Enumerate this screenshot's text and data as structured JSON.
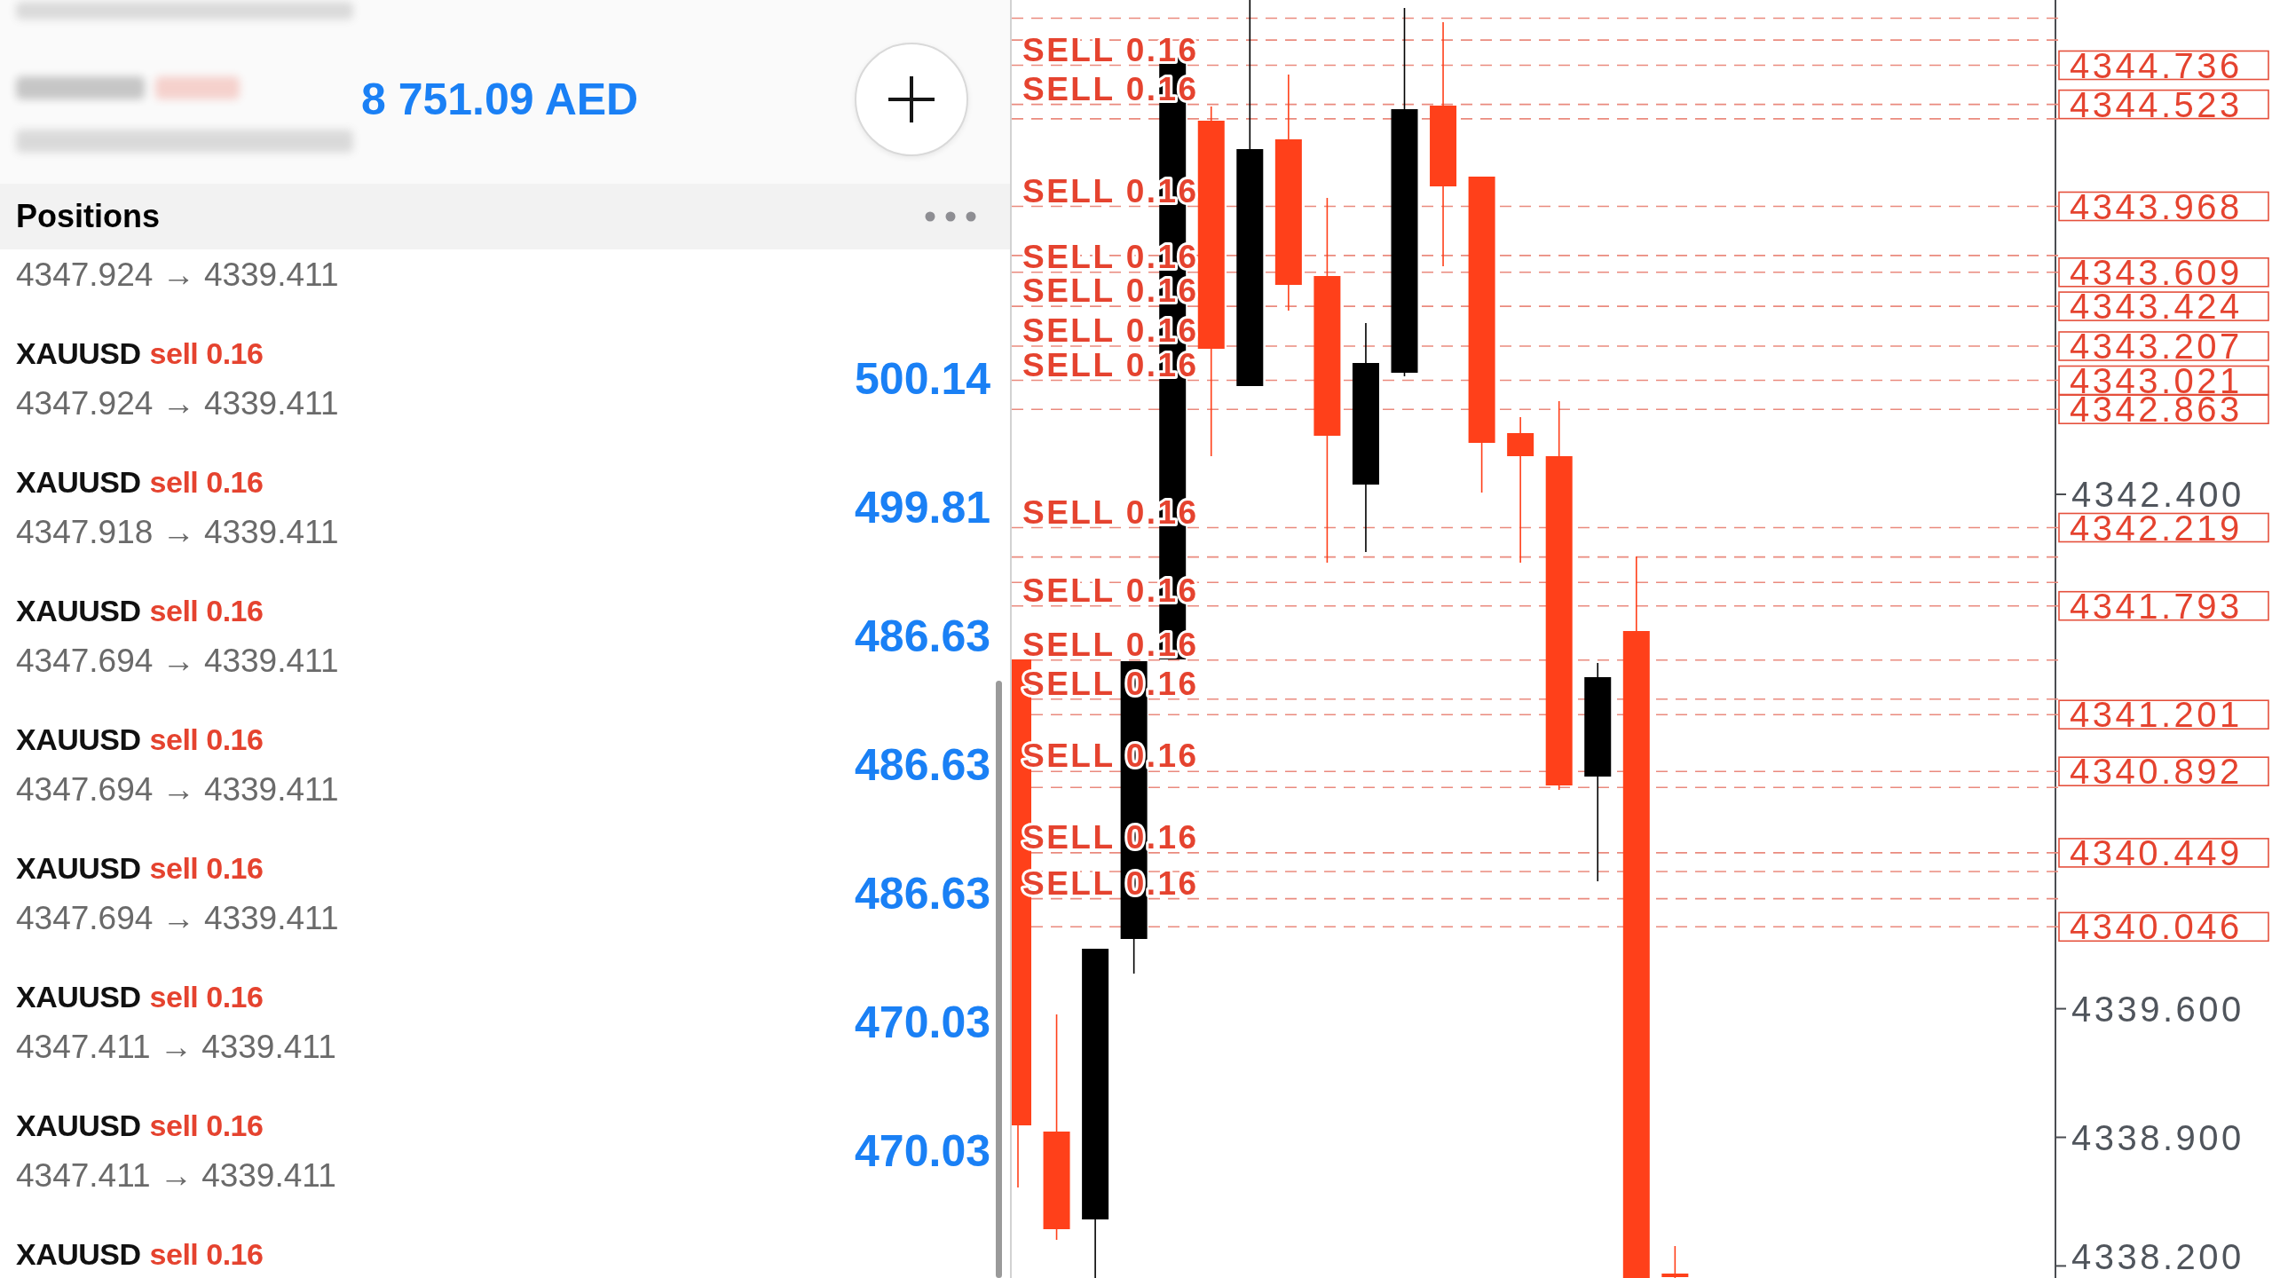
{
  "header": {
    "balance": "8 751.09 AED"
  },
  "positions": {
    "title": "Positions",
    "rows": [
      {
        "price_line": "4347.924 → 4339.411"
      },
      {
        "symbol": "XAUUSD",
        "order": "sell 0.16",
        "price_line": "4347.924 → 4339.411",
        "profit": "500.14"
      },
      {
        "symbol": "XAUUSD",
        "order": "sell 0.16",
        "price_line": "4347.918 → 4339.411",
        "profit": "499.81"
      },
      {
        "symbol": "XAUUSD",
        "order": "sell 0.16",
        "price_line": "4347.694 → 4339.411",
        "profit": "486.63"
      },
      {
        "symbol": "XAUUSD",
        "order": "sell 0.16",
        "price_line": "4347.694 → 4339.411",
        "profit": "486.63"
      },
      {
        "symbol": "XAUUSD",
        "order": "sell 0.16",
        "price_line": "4347.694 → 4339.411",
        "profit": "486.63"
      },
      {
        "symbol": "XAUUSD",
        "order": "sell 0.16",
        "price_line": "4347.411 → 4339.411",
        "profit": "470.03"
      },
      {
        "symbol": "XAUUSD",
        "order": "sell 0.16",
        "price_line": "4347.411 → 4339.411",
        "profit": "470.03"
      },
      {
        "symbol": "XAUUSD",
        "order": "sell 0.16"
      }
    ]
  },
  "chart": {
    "orders": [
      {
        "tag": "4344.736",
        "label": "SELL 0.16"
      },
      {
        "tag": "4344.523",
        "label": "SELL 0.16"
      },
      {
        "tag": "4343.968",
        "label": "SELL 0.16"
      },
      {
        "tag": "4343.609",
        "label": "SELL 0.16"
      },
      {
        "tag": "4343.424",
        "label": "SELL 0.16"
      },
      {
        "tag": "4343.207",
        "label": "SELL 0.16"
      },
      {
        "tag": "4343.021",
        "label": "SELL 0.16"
      },
      {
        "tag": "4342.863"
      },
      {
        "tag": "4342.219",
        "label": "SELL 0.16"
      },
      {
        "tag": "4341.793",
        "label": "SELL 0.16"
      },
      {
        "label": "SELL 0.16"
      },
      {
        "label": "SELL 0.16"
      },
      {
        "tag": "4341.201"
      },
      {
        "tag": "4340.892",
        "label": "SELL 0.16"
      },
      {
        "tag": "4340.449",
        "label": "SELL 0.16"
      },
      {
        "label": "SELL 0.16"
      },
      {
        "tag": "4340.046"
      }
    ],
    "axis_labels": [
      "4342.400",
      "4339.600",
      "4338.900",
      "4338.200"
    ]
  }
}
